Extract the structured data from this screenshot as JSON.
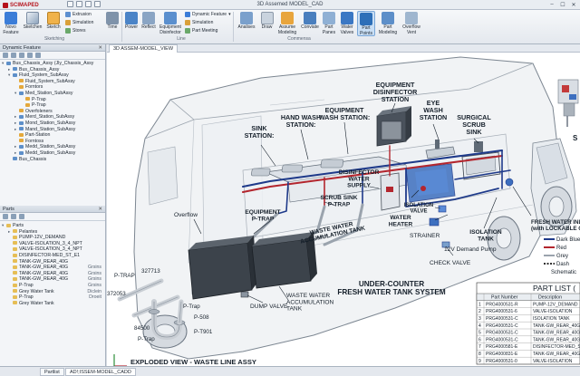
{
  "app": {
    "title": "3D Assemed MODEL_CAD",
    "brand": "SCIMAPED"
  },
  "ribbon": {
    "buttons": [
      {
        "id": "new-feature",
        "label": "Novo\nFeature"
      },
      {
        "id": "sketchen",
        "label": "Sketchen"
      },
      {
        "id": "sketch",
        "label": "Sketch"
      },
      {
        "id": "power",
        "label": "Power"
      },
      {
        "id": "reflect",
        "label": "Reflect"
      },
      {
        "id": "equipment",
        "label": "Equipment\nDisinfector"
      },
      {
        "id": "analises",
        "label": "Analises"
      },
      {
        "id": "draw",
        "label": "Draw"
      },
      {
        "id": "assume",
        "label": "Assume\nModeling"
      },
      {
        "id": "conviate",
        "label": "Conviate"
      },
      {
        "id": "part-panes",
        "label": "Part\nPanes"
      },
      {
        "id": "water-valves",
        "label": "Water\nValves"
      },
      {
        "id": "part-points",
        "label": "Part\nPoints"
      },
      {
        "id": "part-modeling",
        "label": "Part\nModeling"
      },
      {
        "id": "overflow-vent",
        "label": "Overflow\nVent"
      }
    ],
    "small": {
      "extrusion": "Extrusion",
      "simulation": "Simulation",
      "stores": "Stores",
      "time": "Time",
      "dynamic": "Dynamic Feature",
      "sim2": "Simulation",
      "meeting": "Part Meeting"
    },
    "groups": {
      "sketching": "Sketching",
      "line": "Line",
      "commensa": "Commensa"
    }
  },
  "feature_panel": {
    "title": "Dynamic Feature",
    "items": [
      {
        "t": "Bus_Chassis_Assy (Jly_Chassis_Assy",
        "lvl": 0,
        "k": "asm",
        "exp": "v"
      },
      {
        "t": "Bus_Chassis_Assy",
        "lvl": 1,
        "k": "asm",
        "exp": ">"
      },
      {
        "t": "Fluid_System_SubAssy",
        "lvl": 1,
        "k": "asm",
        "exp": "v"
      },
      {
        "t": "Fluid_System_SubAssy",
        "lvl": 2,
        "k": "part",
        "exp": ""
      },
      {
        "t": "Forntors",
        "lvl": 2,
        "k": "part",
        "exp": ""
      },
      {
        "t": "Med_Station_SubAssy",
        "lvl": 2,
        "k": "asm",
        "exp": "v"
      },
      {
        "t": "P-Trap",
        "lvl": 3,
        "k": "part",
        "exp": ""
      },
      {
        "t": "P-Trap",
        "lvl": 3,
        "k": "part",
        "exp": ""
      },
      {
        "t": "Overfoleners",
        "lvl": 2,
        "k": "part",
        "exp": ""
      },
      {
        "t": "Merd_Station_SubAssy",
        "lvl": 2,
        "k": "asm",
        "exp": ">"
      },
      {
        "t": "Mond_Station_SubAssy",
        "lvl": 2,
        "k": "asm",
        "exp": ">"
      },
      {
        "t": "Mand_Station_SubAssy",
        "lvl": 2,
        "k": "asm",
        "exp": ">"
      },
      {
        "t": "Part-Station",
        "lvl": 2,
        "k": "part",
        "exp": ""
      },
      {
        "t": "Forntoss",
        "lvl": 2,
        "k": "part",
        "exp": ""
      },
      {
        "t": "Medd_Station_SubAssy",
        "lvl": 2,
        "k": "asm",
        "exp": ">"
      },
      {
        "t": "Medd_Station_SubAssy",
        "lvl": 2,
        "k": "asm",
        "exp": ">"
      },
      {
        "t": "Bus_Chassis",
        "lvl": 1,
        "k": "asm",
        "exp": ""
      }
    ]
  },
  "parts_panel": {
    "title": "Parts",
    "items": [
      {
        "t": "Parts",
        "lvl": 0,
        "k": "folder",
        "exp": "v",
        "c": ""
      },
      {
        "t": "Pelantes",
        "lvl": 1,
        "k": "folder",
        "exp": ">",
        "c": ""
      },
      {
        "t": "PUMP-12V_DEMAND",
        "lvl": 1,
        "k": "folder",
        "exp": "",
        "c": ""
      },
      {
        "t": "VALVE-ISOLATION_3_4_NPT",
        "lvl": 1,
        "k": "folder",
        "exp": "",
        "c": ""
      },
      {
        "t": "VALVE-ISOLATION_3_4_NPT",
        "lvl": 1,
        "k": "folder",
        "exp": "",
        "c": ""
      },
      {
        "t": "DISINFECTOR-MED_ST_E1",
        "lvl": 1,
        "k": "folder",
        "exp": "",
        "c": ""
      },
      {
        "t": "TANK-GW_REAR_40G",
        "lvl": 1,
        "k": "folder",
        "exp": "",
        "c": ""
      },
      {
        "t": "TANK-GW_REAR_40G",
        "lvl": 1,
        "k": "folder",
        "exp": "",
        "c": "Grsins"
      },
      {
        "t": "TANK-GW_REAR_40G",
        "lvl": 1,
        "k": "folder",
        "exp": "",
        "c": "Grsins"
      },
      {
        "t": "TANK-GW_REAR_40G",
        "lvl": 1,
        "k": "folder",
        "exp": "",
        "c": "Grsins"
      },
      {
        "t": "P-Trap",
        "lvl": 1,
        "k": "folder",
        "exp": "",
        "c": "Grsins"
      },
      {
        "t": "Grey Water Tank",
        "lvl": 1,
        "k": "folder",
        "exp": "",
        "c": "Diclein"
      },
      {
        "t": "P-Trap",
        "lvl": 1,
        "k": "folder",
        "exp": "",
        "c": "Droeit"
      },
      {
        "t": "Grey Water Tank",
        "lvl": 1,
        "k": "folder",
        "exp": "",
        "c": ""
      }
    ]
  },
  "viewport": {
    "tab": "3D ASSEM-MODEL_VIEW"
  },
  "labels": {
    "equip_disinfector": "EQUIPMENT\nDISINFECTOR\nSTATION",
    "hand_wash": "HAND WASH\nSTATION:",
    "equip_wash": "EQUIPMENT\nWASH STATION:",
    "sink_station": "SINK\nSTATION:",
    "eye_wash": "EYE\nWASH\nSTATION",
    "surgical_scrub": "SURGICAL\nSCRUB\nSINK",
    "disinfector_water": "DISINFECTOR\nWATER\nSUPPLY",
    "scrub_sink": "SCRUB SINK\nP-TRAP",
    "waste_water": "WASTE WATER\nACCUMULATION TANK",
    "equipment_ptrap": "EQUIPMENT\nP-TRAP",
    "water_heater": "WATER\nHEATER",
    "isolation_valve": "ISOLATION\nVALVE",
    "overflow": "Overflow",
    "strainer": "STRAINER",
    "demand_pump": "12V Demand Pump",
    "isolation_tank": "ISOLATION\nTANK",
    "fresh_water_inlet": "FRESH WATER INL\n(with LOCKABLE CA",
    "check_valve": "CHECK VALVE",
    "under_counter": "UNDER-COUNTER\nFRESH WATER TANK SYSTEM",
    "dump_valve": "DUMP VALVE",
    "waste_tank": "WASTE WATER\nACCUMULATION\nTANK",
    "p_trap": "P-TRAP",
    "n327713": "327713",
    "n372053": "372053",
    "p_trap2": "P-Trap",
    "p_trap3": "P-Trap",
    "n84500": "84500",
    "p508": "P-508",
    "pt901": "P-T901",
    "exploded": "EXPLODED VIEW - WASTE LINE ASSY",
    "s_char": "S"
  },
  "legend": {
    "items": [
      {
        "label": "Dark Blue",
        "color": "#1e3a8a",
        "kind": "line"
      },
      {
        "label": "Red",
        "color": "#b3262e",
        "kind": "line"
      },
      {
        "label": "Grey",
        "color": "#9aa3ad",
        "kind": "line"
      },
      {
        "label": "Dash",
        "color": "#333333",
        "kind": "dash"
      }
    ],
    "footer": "Schematic"
  },
  "partlist": {
    "title": "PART LIST (",
    "headers": [
      "Part Number",
      "Description"
    ],
    "rows": [
      {
        "n": "1",
        "pn": "PRG4000531-R",
        "d": "PUMP-12V_DEMAND"
      },
      {
        "n": "2",
        "pn": "PRG4000531-6",
        "d": "VALVE-ISOLATION"
      },
      {
        "n": "3",
        "pn": "PRG4000531-C",
        "d": "ISOLATION TANK"
      },
      {
        "n": "4",
        "pn": "PRG4000531-C",
        "d": "TANK-GW_REAR_40G"
      },
      {
        "n": "5",
        "pn": "PRG4000531-C",
        "d": "TANK-GW_REAR_40G"
      },
      {
        "n": "6",
        "pn": "PRG4000531-C",
        "d": "TANK-GW_REAR_40G"
      },
      {
        "n": "7",
        "pn": "PRG4000581-E",
        "d": "DISINFECTOR-MED_ST"
      },
      {
        "n": "8",
        "pn": "PRG4000831-E",
        "d": "TANK-GW_REAR_40G"
      },
      {
        "n": "9",
        "pn": "PRG4000531-0",
        "d": "VALVE-ISOLATION"
      }
    ]
  },
  "bottom": {
    "partlist_tab": "Partlist",
    "doc_tab": "AD!;ISSEM-MODEL_CADD"
  },
  "colors": {
    "accent": "#2d6fb8",
    "brand": "#b5121b",
    "fresh": "#1e3a8a",
    "hot": "#b3262e"
  }
}
